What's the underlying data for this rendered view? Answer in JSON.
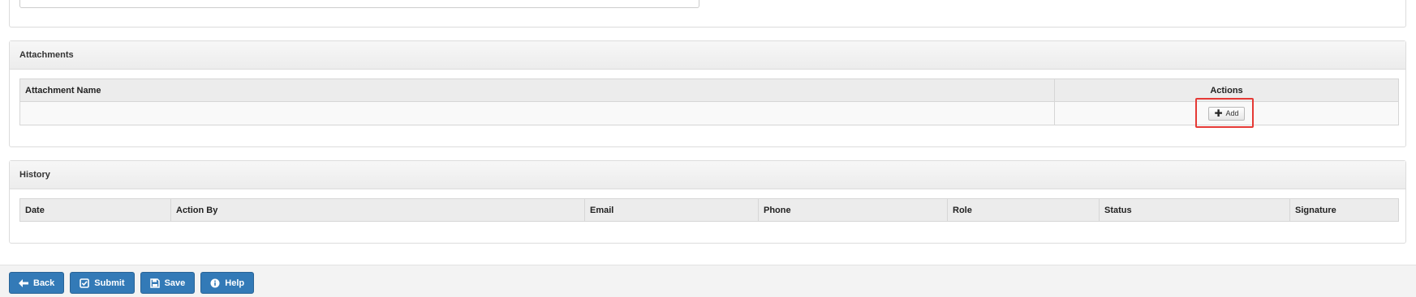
{
  "attachments": {
    "title": "Attachments",
    "columns": [
      "Attachment Name",
      "Actions"
    ],
    "add_label": "Add"
  },
  "history": {
    "title": "History",
    "columns": [
      "Date",
      "Action By",
      "Email",
      "Phone",
      "Role",
      "Status",
      "Signature"
    ]
  },
  "footer": {
    "back_label": "Back",
    "submit_label": "Submit",
    "save_label": "Save",
    "help_label": "Help"
  },
  "colors": {
    "primary_button": "#337ab7",
    "highlight": "#e53935"
  },
  "icons": {
    "add": "plus-icon",
    "back": "arrow-left-icon",
    "submit": "check-square-icon",
    "save": "save-icon",
    "help": "info-circle-icon"
  }
}
